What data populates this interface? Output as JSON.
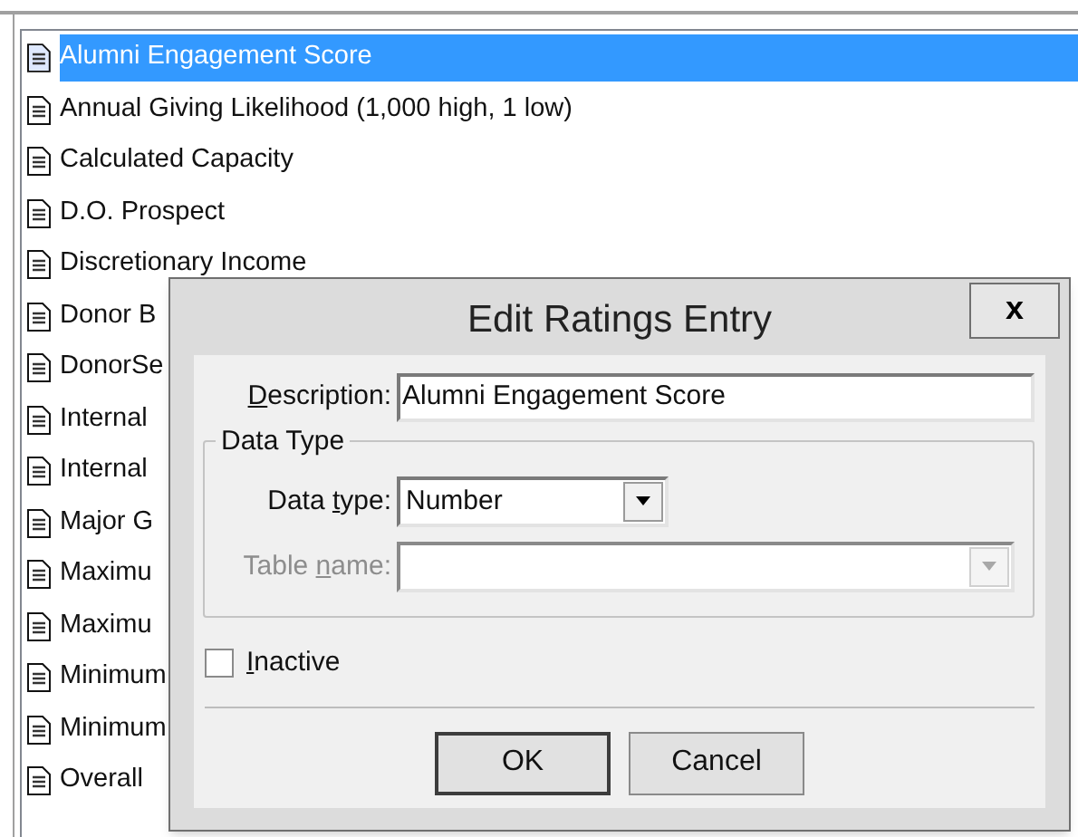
{
  "list": {
    "items": [
      {
        "label": "Alumni Engagement Score",
        "selected": true
      },
      {
        "label": "Annual Giving Likelihood (1,000 high, 1 low)",
        "selected": false
      },
      {
        "label": "Calculated Capacity",
        "selected": false
      },
      {
        "label": "D.O. Prospect",
        "selected": false
      },
      {
        "label": "Discretionary Income",
        "selected": false
      },
      {
        "label": "Donor B",
        "selected": false
      },
      {
        "label": "DonorSe",
        "selected": false
      },
      {
        "label": "Internal",
        "selected": false
      },
      {
        "label": "Internal",
        "selected": false
      },
      {
        "label": "Major G",
        "selected": false
      },
      {
        "label": "Maximu",
        "selected": false
      },
      {
        "label": "Maximu",
        "selected": false
      },
      {
        "label": "Minimum",
        "selected": false
      },
      {
        "label": "Minimum",
        "selected": false
      },
      {
        "label": "Overall",
        "selected": false
      }
    ]
  },
  "dialog": {
    "title": "Edit Ratings Entry",
    "close": "x",
    "description": {
      "label": {
        "key": "D",
        "after": "escription:"
      },
      "value": "Alumni Engagement Score"
    },
    "data_type_group": {
      "title": "Data Type",
      "data_type": {
        "label": {
          "before": "Data ",
          "key": "t",
          "after": "ype:"
        },
        "value": "Number",
        "disabled": false
      },
      "table_name": {
        "label": {
          "before": "Table ",
          "key": "n",
          "after": "ame:"
        },
        "disabled": true
      }
    },
    "inactive": {
      "label": {
        "key": "I",
        "after": "nactive"
      },
      "checked": false
    },
    "buttons": [
      {
        "label": "OK",
        "default": true
      },
      {
        "label": "Cancel",
        "default": false
      }
    ]
  }
}
